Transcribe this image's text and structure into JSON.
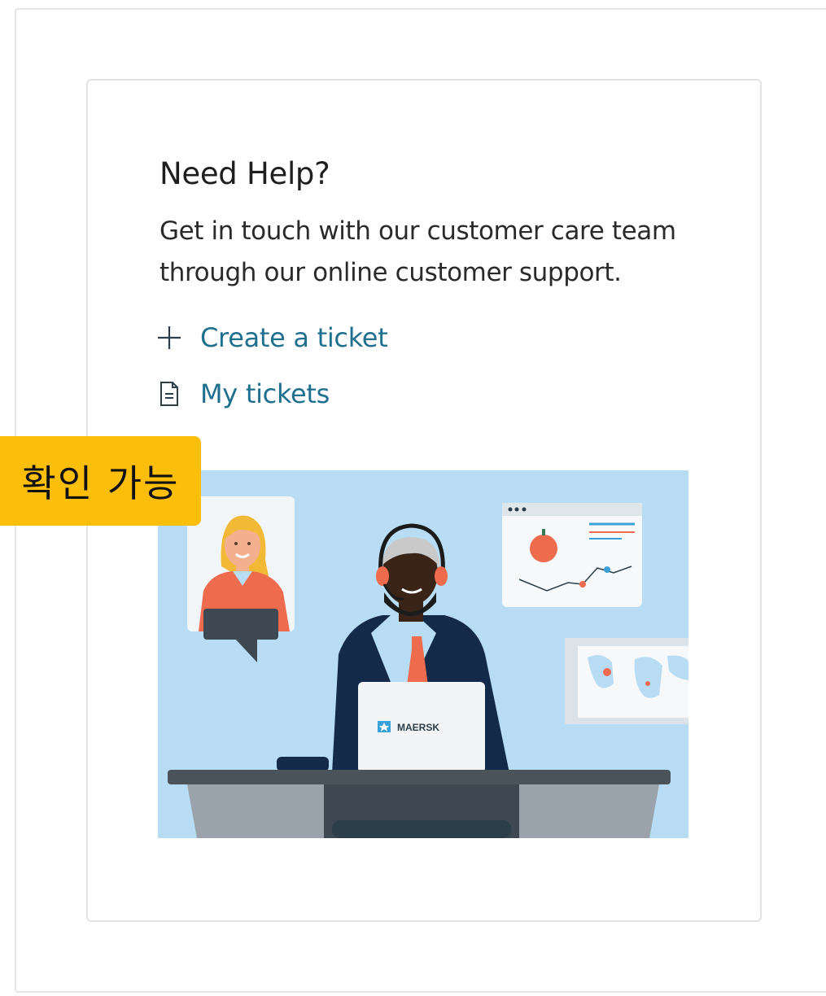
{
  "card": {
    "title": "Need Help?",
    "description": "Get in touch with our customer care team through our online customer support.",
    "links": [
      {
        "label": "Create a ticket",
        "icon": "plus-icon"
      },
      {
        "label": "My tickets",
        "icon": "document-icon"
      }
    ]
  },
  "illustration": {
    "laptop_logo_text": "MAERSK",
    "subject": "customer-support-agent"
  },
  "badge": {
    "label": "확인 가능"
  },
  "colors": {
    "link": "#1f6f8f",
    "illustration_background": "#b7dcf3",
    "badge": "#fbbe0a"
  }
}
